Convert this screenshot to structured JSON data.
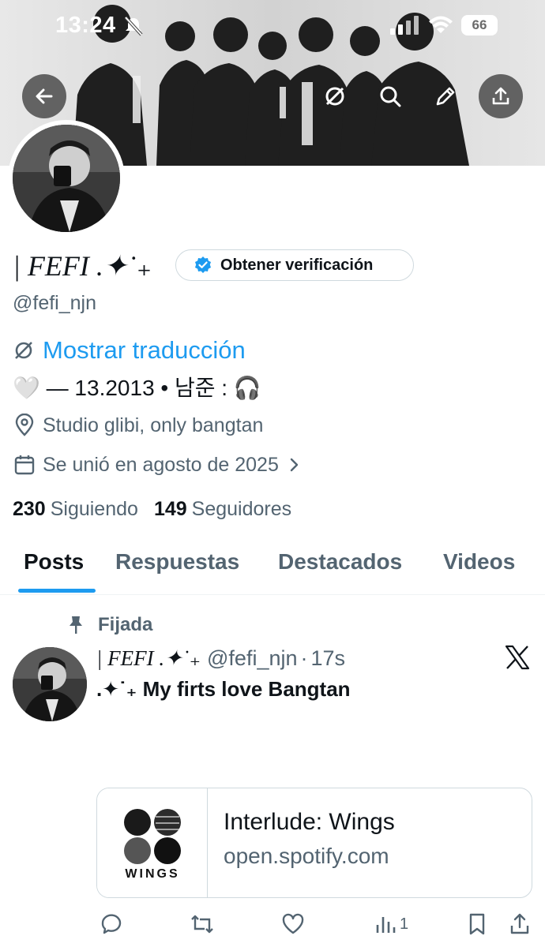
{
  "status_bar": {
    "time": "13:24",
    "battery": "66"
  },
  "profile": {
    "display_name": "| FEFI .✦˙₊",
    "verify_button": "Obtener verificación",
    "handle": "@fefi_njn",
    "translate_link": "Mostrar traducción",
    "bio": "🤍 ― 13.2013 • 남준 : 🎧",
    "location": "Studio glibi, only bangtan",
    "joined": "Se unió en agosto de 2025",
    "following_count": "230",
    "following_label": "Siguiendo",
    "followers_count": "149",
    "followers_label": "Seguidores"
  },
  "tabs": [
    {
      "label": "Posts",
      "active": true
    },
    {
      "label": "Respuestas",
      "active": false
    },
    {
      "label": "Destacados",
      "active": false
    },
    {
      "label": "Videos",
      "active": false
    }
  ],
  "post": {
    "pinned_label": "Fijada",
    "author_name": "| FEFI .✦˙₊",
    "author_handle": "@fefi_njn",
    "separator": "·",
    "time": "17s",
    "text": ".✦˙₊ My firts love Bangtan",
    "card": {
      "thumb_text": "WINGS",
      "title": "Interlude: Wings",
      "domain": "open.spotify.com"
    },
    "views_count": "1"
  },
  "icons": {
    "back": "arrow-left-icon",
    "translate": "translate-icon",
    "search": "search-icon",
    "edit": "pencil-icon",
    "share": "share-icon",
    "verified": "verified-badge-icon",
    "location": "map-pin-icon",
    "calendar": "calendar-icon",
    "chevron": "chevron-right-icon",
    "pin": "pin-icon",
    "x": "x-logo-icon",
    "reply": "reply-icon",
    "retweet": "repost-icon",
    "like": "heart-icon",
    "views": "views-icon",
    "bookmark": "bookmark-icon"
  },
  "colors": {
    "accent": "#1d9bf0",
    "text_primary": "#0f1419",
    "text_secondary": "#536471",
    "border": "#cfd9de"
  }
}
